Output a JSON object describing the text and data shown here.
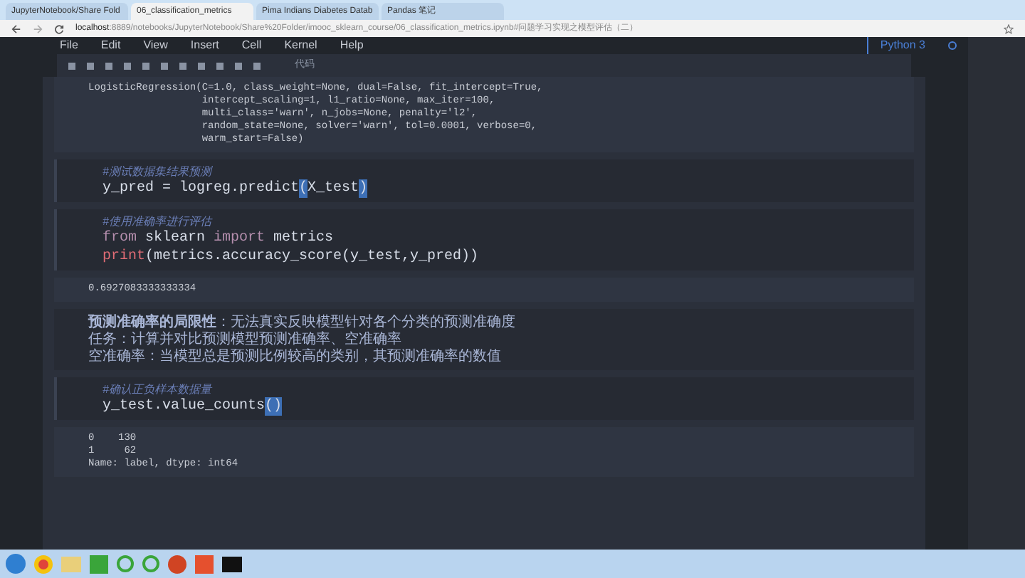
{
  "browser": {
    "tabs": [
      {
        "title": "JupyterNotebook/Share Fold",
        "selected": false
      },
      {
        "title": "06_classification_metrics",
        "selected": true
      },
      {
        "title": "Pima Indians Diabetes Datab",
        "selected": false
      },
      {
        "title": "Pandas 笔记",
        "selected": false
      }
    ],
    "url_host": "localhost",
    "url_rest": ":8889/notebooks/JupyterNotebook/Share%20Folder/imooc_sklearn_course/06_classification_metrics.ipynb#问题学习实现之模型评估（二）"
  },
  "menu": [
    "File",
    "Edit",
    "View",
    "Insert",
    "Cell",
    "Kernel",
    "Help"
  ],
  "toolbar": {
    "cell_type": "代码"
  },
  "kernel": "Python 3",
  "cells": [
    {
      "kind": "output",
      "lines": [
        "LogisticRegression(C=1.0, class_weight=None, dual=False, fit_intercept=True,",
        "                   intercept_scaling=1, l1_ratio=None, max_iter=100,",
        "                   multi_class='warn', n_jobs=None, penalty='l2',",
        "                   random_state=None, solver='warn', tol=0.0001, verbose=0,",
        "                   warm_start=False)"
      ]
    },
    {
      "kind": "code",
      "comment": "#测试数据集结果预测",
      "lines": [
        [
          {
            "text": "y_pred = logreg.predict",
            "kind": "plain"
          },
          {
            "text": "(",
            "kind": "match"
          },
          {
            "text": "X_test",
            "kind": "plain"
          },
          {
            "text": ")",
            "kind": "match"
          }
        ]
      ]
    },
    {
      "kind": "code",
      "comment": "#使用准确率进行评估",
      "lines": [
        [
          {
            "text": "from",
            "kind": "keyword"
          },
          {
            "text": " sklearn ",
            "kind": "plain"
          },
          {
            "text": "import",
            "kind": "keyword"
          },
          {
            "text": " metrics",
            "kind": "plain"
          }
        ],
        [
          {
            "text": "print",
            "kind": "builtin"
          },
          {
            "text": "(metrics.accuracy_score(y_test,y_pred))",
            "kind": "plain"
          }
        ]
      ]
    },
    {
      "kind": "output",
      "lines": [
        "0.6927083333333334"
      ]
    },
    {
      "kind": "markdown",
      "lines": [
        "**预测准确率的局限性**：无法真实反映模型针对各个分类的预测准确度",
        "任务：计算并对比预测模型预测准确率、空准确率",
        "空准确率：当模型总是预测比例较高的类别，其预测准确率的数值"
      ]
    },
    {
      "kind": "code",
      "comment": "#确认正负样本数据量",
      "lines": [
        [
          {
            "text": "y_test.value_counts",
            "kind": "plain"
          },
          {
            "text": "()",
            "kind": "match"
          }
        ]
      ]
    },
    {
      "kind": "output",
      "lines": [
        "0    130",
        "1     62",
        "Name: label, dtype: int64"
      ]
    }
  ]
}
